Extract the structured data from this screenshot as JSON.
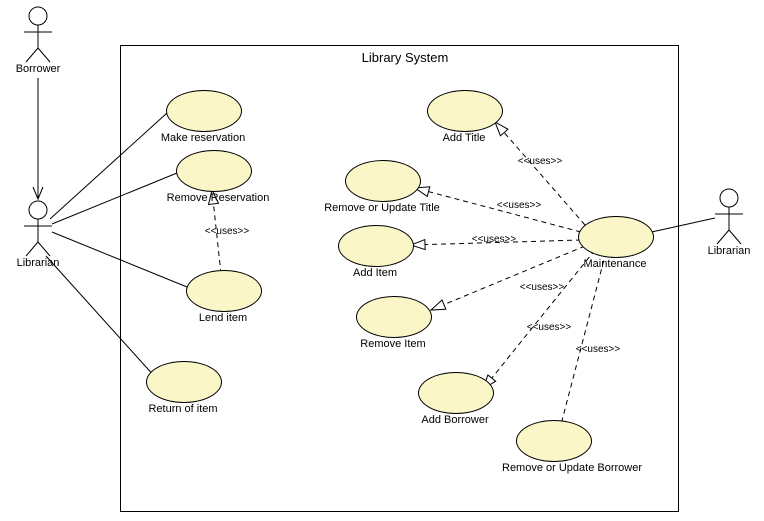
{
  "system": {
    "title": "Library System"
  },
  "actors": {
    "borrower": "Borrower",
    "librarian_left": "Librarian",
    "librarian_right": "Librarian"
  },
  "usecases": {
    "make_reservation": "Make reservation",
    "remove_reservation": "Remove Reservation",
    "lend_item": "Lend item",
    "return_item": "Return of item",
    "add_title": "Add Title",
    "remove_update_title": "Remove or Update Title",
    "add_item": "Add Item",
    "remove_item": "Remove Item",
    "add_borrower": "Add Borrower",
    "remove_update_borrower": "Remove or Update Borrower",
    "maintenance": "Maintenance"
  },
  "stereotypes": {
    "uses": "<<uses>>"
  },
  "chart_data": {
    "type": "uml-usecase",
    "title": "Library System",
    "actors": [
      "Borrower",
      "Librarian",
      "Librarian"
    ],
    "usecases": [
      "Make reservation",
      "Remove Reservation",
      "Lend item",
      "Return of item",
      "Add Title",
      "Remove or Update Title",
      "Add Item",
      "Remove Item",
      "Add Borrower",
      "Remove or Update Borrower",
      "Maintenance"
    ],
    "associations": [
      {
        "from": "Borrower",
        "to": "Librarian",
        "type": "solid-open"
      },
      {
        "from": "Librarian",
        "to": "Make reservation",
        "type": "solid"
      },
      {
        "from": "Librarian",
        "to": "Remove Reservation",
        "type": "solid"
      },
      {
        "from": "Librarian",
        "to": "Lend item",
        "type": "solid"
      },
      {
        "from": "Librarian",
        "to": "Return of item",
        "type": "solid"
      },
      {
        "from": "Lend item",
        "to": "Remove Reservation",
        "type": "uses"
      },
      {
        "from": "Maintenance",
        "to": "Add Title",
        "type": "uses"
      },
      {
        "from": "Maintenance",
        "to": "Remove or Update Title",
        "type": "uses"
      },
      {
        "from": "Maintenance",
        "to": "Add Item",
        "type": "uses"
      },
      {
        "from": "Maintenance",
        "to": "Remove Item",
        "type": "uses"
      },
      {
        "from": "Maintenance",
        "to": "Add Borrower",
        "type": "uses"
      },
      {
        "from": "Maintenance",
        "to": "Remove or Update Borrower",
        "type": "uses"
      },
      {
        "from": "Librarian (right)",
        "to": "Maintenance",
        "type": "solid"
      }
    ]
  }
}
